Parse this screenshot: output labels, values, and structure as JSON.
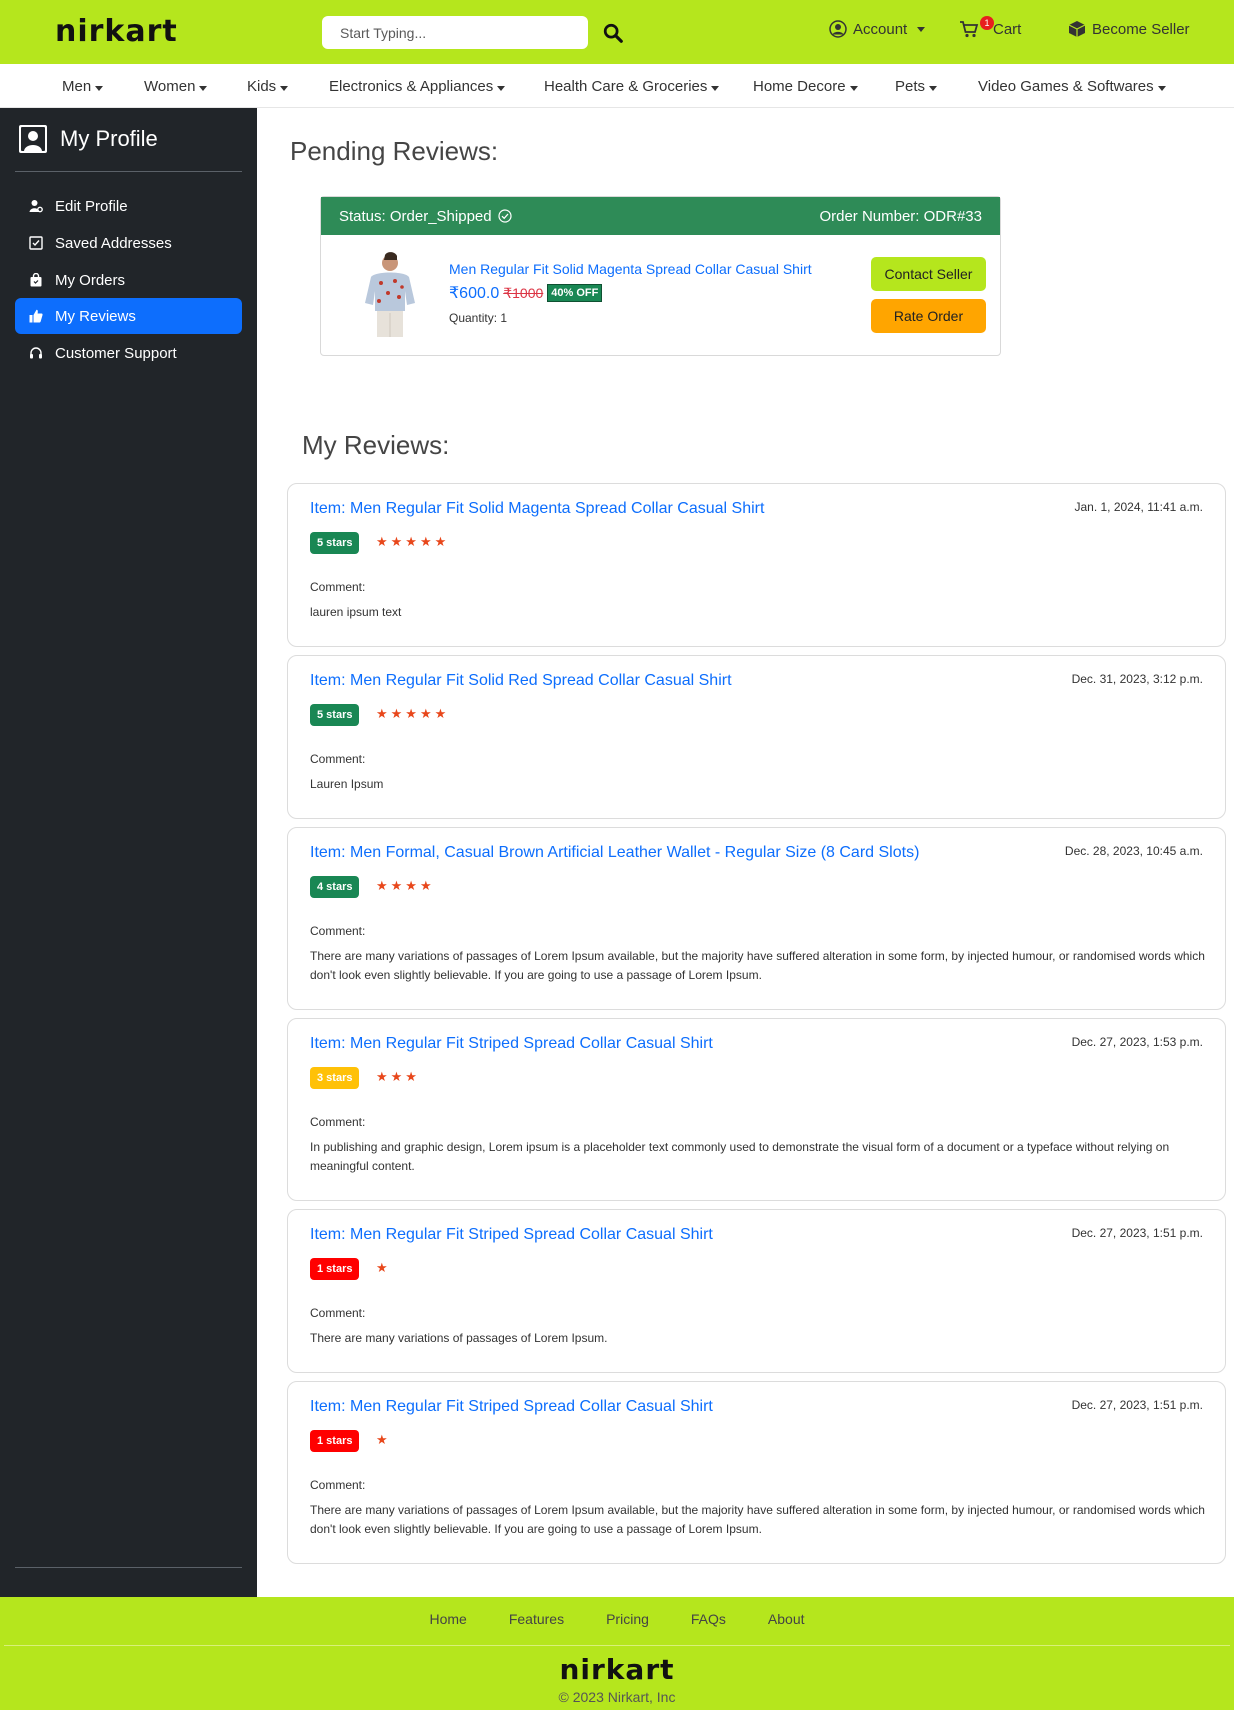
{
  "header": {
    "logo": "nirkart",
    "search_placeholder": "Start Typing...",
    "account_label": "Account",
    "cart_label": "Cart",
    "cart_count": "1",
    "seller_label": "Become Seller",
    "brand_color": "#b5e61d"
  },
  "categories": [
    "Men",
    "Women",
    "Kids",
    "Electronics & Appliances",
    "Health Care & Groceries",
    "Home Decore",
    "Pets",
    "Video Games & Softwares"
  ],
  "sidebar": {
    "title": "My Profile",
    "items": [
      {
        "label": "Edit Profile",
        "icon": "user-gear-icon"
      },
      {
        "label": "Saved Addresses",
        "icon": "address-card-icon"
      },
      {
        "label": "My Orders",
        "icon": "shopping-bag-icon"
      },
      {
        "label": "My Reviews",
        "icon": "thumbs-up-icon",
        "active": true
      },
      {
        "label": "Customer Support",
        "icon": "headset-icon"
      }
    ]
  },
  "pending": {
    "heading": "Pending Reviews:",
    "status": "Status: Order_Shipped",
    "order_number": "Order Number: ODR#33",
    "product": "Men Regular Fit Solid Magenta Spread Collar Casual Shirt",
    "price": "₹600.0",
    "mrp": "₹1000",
    "discount": "40% OFF",
    "quantity": "Quantity: 1",
    "contact_label": "Contact Seller",
    "rate_label": "Rate Order"
  },
  "reviews_section": {
    "heading": "My Reviews:",
    "comment_label": "Comment:",
    "items": [
      {
        "title": "Item: Men Regular Fit Solid Magenta Spread Collar Casual Shirt",
        "date": "Jan. 1, 2024, 11:41 a.m.",
        "rating": 5,
        "badge": "5 stars",
        "badge_color": "#198754",
        "comment": "lauren ipsum text"
      },
      {
        "title": "Item: Men Regular Fit Solid Red Spread Collar Casual Shirt",
        "date": "Dec. 31, 2023, 3:12 p.m.",
        "rating": 5,
        "badge": "5 stars",
        "badge_color": "#198754",
        "comment": "Lauren Ipsum"
      },
      {
        "title": "Item: Men Formal, Casual Brown Artificial Leather Wallet - Regular Size (8 Card Slots)",
        "date": "Dec. 28, 2023, 10:45 a.m.",
        "rating": 4,
        "badge": "4 stars",
        "badge_color": "#198754",
        "comment": "There are many variations of passages of Lorem Ipsum available, but the majority have suffered alteration in some form, by injected humour, or randomised words which don't look even slightly believable. If you are going to use a passage of Lorem Ipsum."
      },
      {
        "title": "Item: Men Regular Fit Striped Spread Collar Casual Shirt",
        "date": "Dec. 27, 2023, 1:53 p.m.",
        "rating": 3,
        "badge": "3 stars",
        "badge_color": "#ffc107",
        "comment": "In publishing and graphic design, Lorem ipsum is a placeholder text commonly used to demonstrate the visual form of a document or a typeface without relying on meaningful content."
      },
      {
        "title": "Item: Men Regular Fit Striped Spread Collar Casual Shirt",
        "date": "Dec. 27, 2023, 1:51 p.m.",
        "rating": 1,
        "badge": "1 stars",
        "badge_color": "#ff0000",
        "comment": "There are many variations of passages of Lorem Ipsum."
      },
      {
        "title": "Item: Men Regular Fit Striped Spread Collar Casual Shirt",
        "date": "Dec. 27, 2023, 1:51 p.m.",
        "rating": 1,
        "badge": "1 stars",
        "badge_color": "#ff0000",
        "comment": "There are many variations of passages of Lorem Ipsum available, but the majority have suffered alteration in some form, by injected humour, or randomised words which don't look even slightly believable. If you are going to use a passage of Lorem Ipsum."
      }
    ]
  },
  "footer": {
    "links": [
      "Home",
      "Features",
      "Pricing",
      "FAQs",
      "About"
    ],
    "logo": "nirkart",
    "copyright": "© 2023 Nirkart, Inc"
  }
}
